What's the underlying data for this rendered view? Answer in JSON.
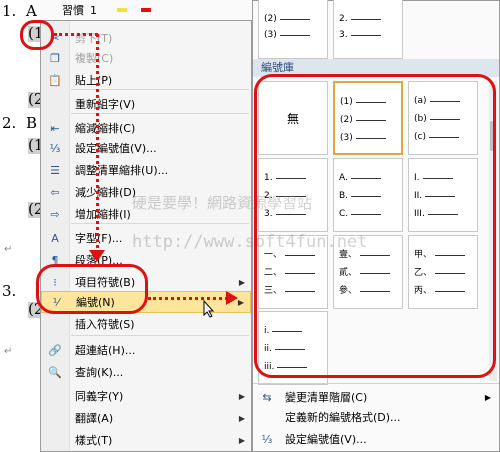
{
  "document": {
    "lines": [
      "1.",
      "A",
      "(1",
      "(2",
      "2.",
      "B",
      "(1",
      "(2",
      "3.",
      "(2"
    ],
    "para_mark": "↵"
  },
  "format_bar": {
    "style_label": "習慣",
    "font_label": "1"
  },
  "context_menu": {
    "items": [
      {
        "label": "剪下(T)",
        "icon": "scissors-icon",
        "glyph": "✂",
        "disabled": true
      },
      {
        "label": "複製(C)",
        "icon": "copy-icon",
        "glyph": "❐",
        "disabled": true
      },
      {
        "label": "貼上(P)",
        "icon": "paste-icon",
        "glyph": "📋",
        "disabled": false
      },
      {
        "label": "重新組字(V)",
        "icon": "none",
        "glyph": "",
        "disabled": false
      },
      {
        "label": "縮減縮排(C)",
        "icon": "decrease-indent-icon",
        "glyph": "⇤",
        "disabled": false
      },
      {
        "label": "設定編號值(V)...",
        "icon": "numbering-value-icon",
        "glyph": "⅓",
        "disabled": false
      },
      {
        "label": "調整清單縮排(U)...",
        "icon": "list-indent-icon",
        "glyph": "☰",
        "disabled": false
      },
      {
        "label": "減少縮排(D)",
        "icon": "outdent-icon",
        "glyph": "⇦",
        "disabled": false
      },
      {
        "label": "增加縮排(I)",
        "icon": "indent-icon",
        "glyph": "⇨",
        "disabled": false
      },
      {
        "label": "字型(F)...",
        "icon": "font-icon",
        "glyph": "A",
        "disabled": false
      },
      {
        "label": "段落(P)...",
        "icon": "paragraph-icon",
        "glyph": "¶",
        "disabled": false
      },
      {
        "label": "項目符號(B)",
        "icon": "bullets-icon",
        "glyph": "⁝",
        "disabled": false,
        "submenu": true
      },
      {
        "label": "編號(N)",
        "icon": "numbering-icon",
        "glyph": "⅟",
        "disabled": false,
        "submenu": true,
        "highlighted": true
      },
      {
        "label": "插入符號(S)",
        "icon": "none",
        "glyph": "",
        "disabled": false
      },
      {
        "label": "超連結(H)...",
        "icon": "hyperlink-icon",
        "glyph": "🔗",
        "disabled": false
      },
      {
        "label": "查詢(K)...",
        "icon": "lookup-icon",
        "glyph": "🔍",
        "disabled": false
      },
      {
        "label": "同義字(Y)",
        "icon": "none",
        "glyph": "",
        "disabled": false,
        "submenu": true
      },
      {
        "label": "翻譯(A)",
        "icon": "none",
        "glyph": "",
        "disabled": false,
        "submenu": true
      },
      {
        "label": "樣式(T)",
        "icon": "none",
        "glyph": "",
        "disabled": false,
        "submenu": true
      }
    ]
  },
  "numbering_submenu": {
    "top_partial": {
      "left": [
        "(2)",
        "(3)"
      ],
      "right": [
        "2.",
        "3."
      ]
    },
    "library_header": "編號庫",
    "tiles": [
      {
        "none_label": "無"
      },
      {
        "rows": [
          "(1)",
          "(2)",
          "(3)"
        ],
        "selected": true
      },
      {
        "rows": [
          "(a)",
          "(b)",
          "(c)"
        ]
      },
      {
        "rows": [
          "1.",
          "2.",
          "3."
        ]
      },
      {
        "rows": [
          "A.",
          "B.",
          "C."
        ]
      },
      {
        "rows": [
          "I.",
          "II.",
          "III."
        ]
      },
      {
        "rows": [
          "一、",
          "二、",
          "三、"
        ]
      },
      {
        "rows": [
          "壹、",
          "貳、",
          "參、"
        ]
      },
      {
        "rows": [
          "甲、",
          "乙、",
          "丙、"
        ]
      },
      {
        "rows": [
          "i.",
          "ii.",
          "iii."
        ]
      }
    ],
    "footer": [
      {
        "label": "變更清單階層(C)",
        "icon": "list-level-icon",
        "glyph": "⇆",
        "submenu": true
      },
      {
        "label": "定義新的編號格式(D)...",
        "icon": "none",
        "glyph": ""
      },
      {
        "label": "設定編號值(V)...",
        "icon": "set-value-icon",
        "glyph": "⅓"
      }
    ]
  },
  "watermark": {
    "line1": "硬是要學！網路資源學習站",
    "line2": "http://www.soft4fun.net"
  },
  "accent_color": "#e01010"
}
